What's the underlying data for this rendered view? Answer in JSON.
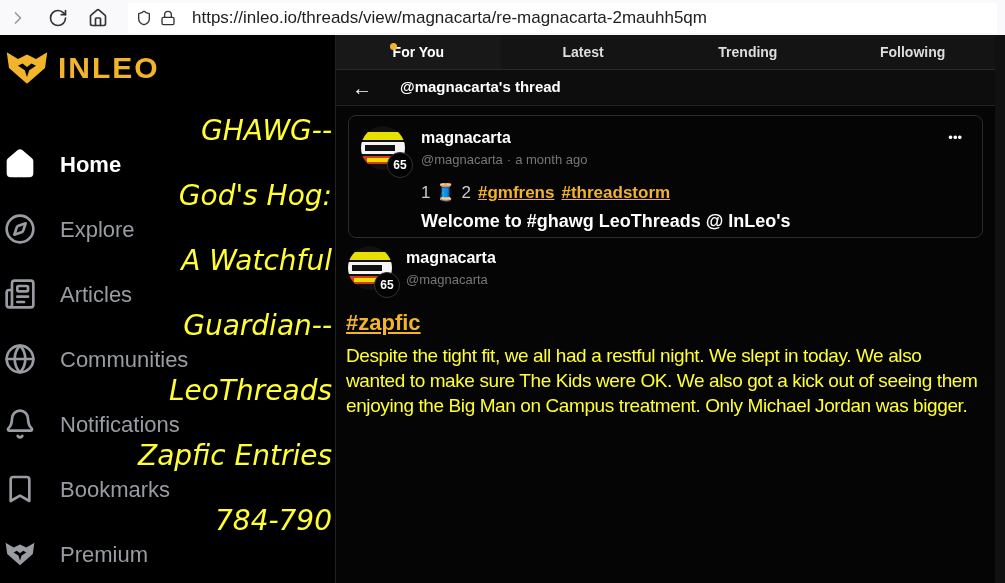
{
  "browser": {
    "url": "https://inleo.io/threads/view/magnacarta/re-magnacarta-2mauhh5qm"
  },
  "sidebar": {
    "logo": "INLEO",
    "items": [
      {
        "label": "Home",
        "kind": "home",
        "selected": true
      },
      {
        "label": "Explore",
        "kind": "explore",
        "selected": false
      },
      {
        "label": "Articles",
        "kind": "articles",
        "selected": false
      },
      {
        "label": "Communities",
        "kind": "communities",
        "selected": false
      },
      {
        "label": "Notifications",
        "kind": "notifications",
        "selected": false
      },
      {
        "label": "Bookmarks",
        "kind": "bookmarks",
        "selected": false
      },
      {
        "label": "Premium",
        "kind": "premium",
        "selected": false
      }
    ]
  },
  "overlay_note": [
    "GHAWG--",
    "God's Hog:",
    "A Watchful",
    "Guardian--",
    "LeoThreads",
    "Zapfic Entries",
    "784-790"
  ],
  "tabs": [
    {
      "label": "For You",
      "selected": true
    },
    {
      "label": "Latest",
      "selected": false
    },
    {
      "label": "Trending",
      "selected": false
    },
    {
      "label": "Following",
      "selected": false
    }
  ],
  "thread_header": {
    "back": "←",
    "title": "@magnacarta's thread"
  },
  "parent_post": {
    "author": "magnacarta",
    "handle": "@magnacarta",
    "separator": "·",
    "time": "a month ago",
    "reputation": "65",
    "more": "•••",
    "line": [
      "1",
      "🧵",
      "2"
    ],
    "tags": [
      "#gmfrens",
      "#threadstorm"
    ],
    "cut_text": "Welcome to #ghawg LeoThreads @ InLeo's"
  },
  "reply": {
    "author": "magnacarta",
    "handle": "@magnacarta",
    "reputation": "65",
    "tag": "#zapfic",
    "body": "Despite the tight fit, we all had a restful night. We slept in today. We also wanted to make sure The Kids were OK. We also got a kick out of seeing them enjoying the Big Man on Campus treatment. Only Michael Jordan was bigger."
  }
}
